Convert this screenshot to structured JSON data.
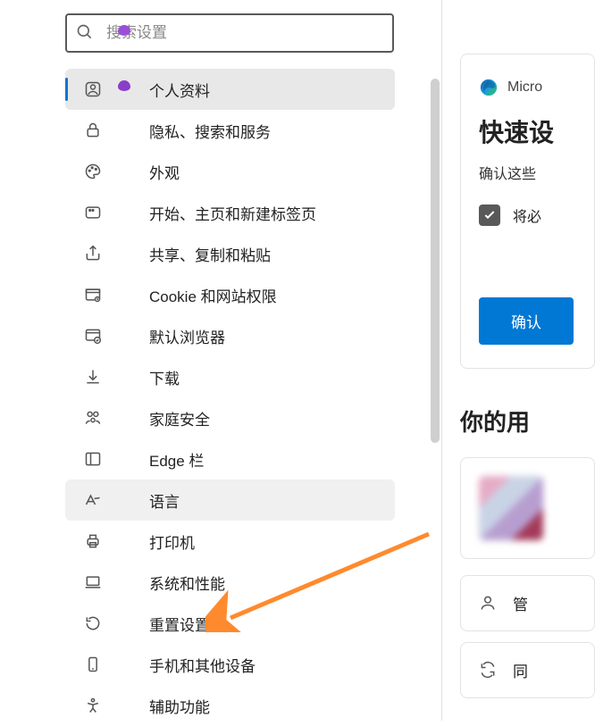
{
  "search": {
    "placeholder": "搜索设置"
  },
  "sidebar": {
    "items": [
      {
        "label": "个人资料",
        "active": true
      },
      {
        "label": "隐私、搜索和服务"
      },
      {
        "label": "外观"
      },
      {
        "label": "开始、主页和新建标签页"
      },
      {
        "label": "共享、复制和粘贴"
      },
      {
        "label": "Cookie 和网站权限"
      },
      {
        "label": "默认浏览器"
      },
      {
        "label": "下载"
      },
      {
        "label": "家庭安全"
      },
      {
        "label": "Edge 栏"
      },
      {
        "label": "语言",
        "hover": true
      },
      {
        "label": "打印机"
      },
      {
        "label": "系统和性能"
      },
      {
        "label": "重置设置"
      },
      {
        "label": "手机和其他设备"
      },
      {
        "label": "辅助功能"
      }
    ]
  },
  "main": {
    "brand": "Micro",
    "card_title": "快速设",
    "card_desc": "确认这些",
    "checkbox_label": "将必",
    "confirm": "确认",
    "section_title": "你的用",
    "manage_label": "管",
    "sync_label": "同"
  }
}
